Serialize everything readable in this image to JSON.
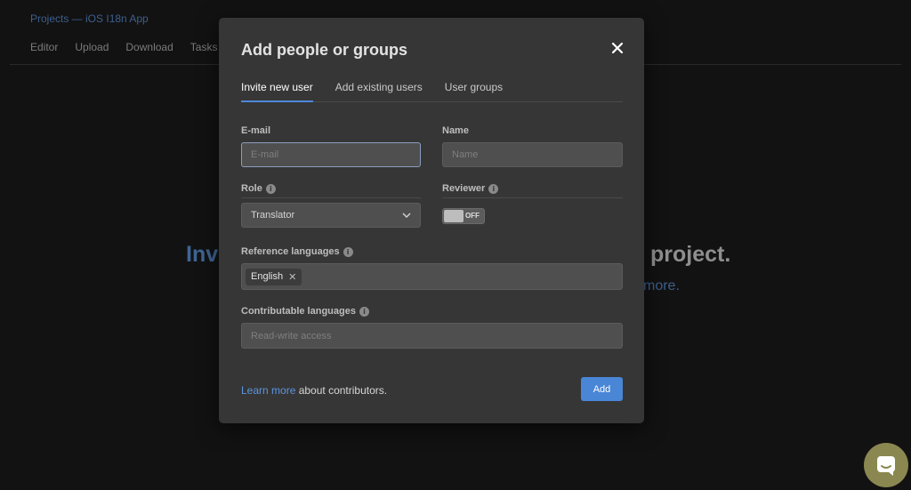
{
  "background": {
    "breadcrumb": "Projects — iOS I18n App",
    "nav": [
      "Editor",
      "Upload",
      "Download",
      "Tasks"
    ],
    "headline_left": "Inv",
    "headline_right": "project.",
    "sub_right": "more."
  },
  "modal": {
    "title": "Add people or groups",
    "tabs": [
      {
        "label": "Invite new user",
        "active": true
      },
      {
        "label": "Add existing users",
        "active": false
      },
      {
        "label": "User groups",
        "active": false
      }
    ],
    "email": {
      "label": "E-mail",
      "placeholder": "E-mail"
    },
    "name": {
      "label": "Name",
      "placeholder": "Name"
    },
    "role": {
      "label": "Role",
      "value": "Translator"
    },
    "reviewer": {
      "label": "Reviewer",
      "toggle_text": "OFF"
    },
    "reference_languages": {
      "label": "Reference languages",
      "chips": [
        "English"
      ]
    },
    "contributable_languages": {
      "label": "Contributable languages",
      "placeholder": "Read-write access"
    },
    "footer": {
      "link": "Learn more",
      "text": " about contributors."
    },
    "add_label": "Add"
  },
  "colors": {
    "accent": "#4a86d6",
    "link": "#5b95e0",
    "modal_bg": "#363636"
  }
}
